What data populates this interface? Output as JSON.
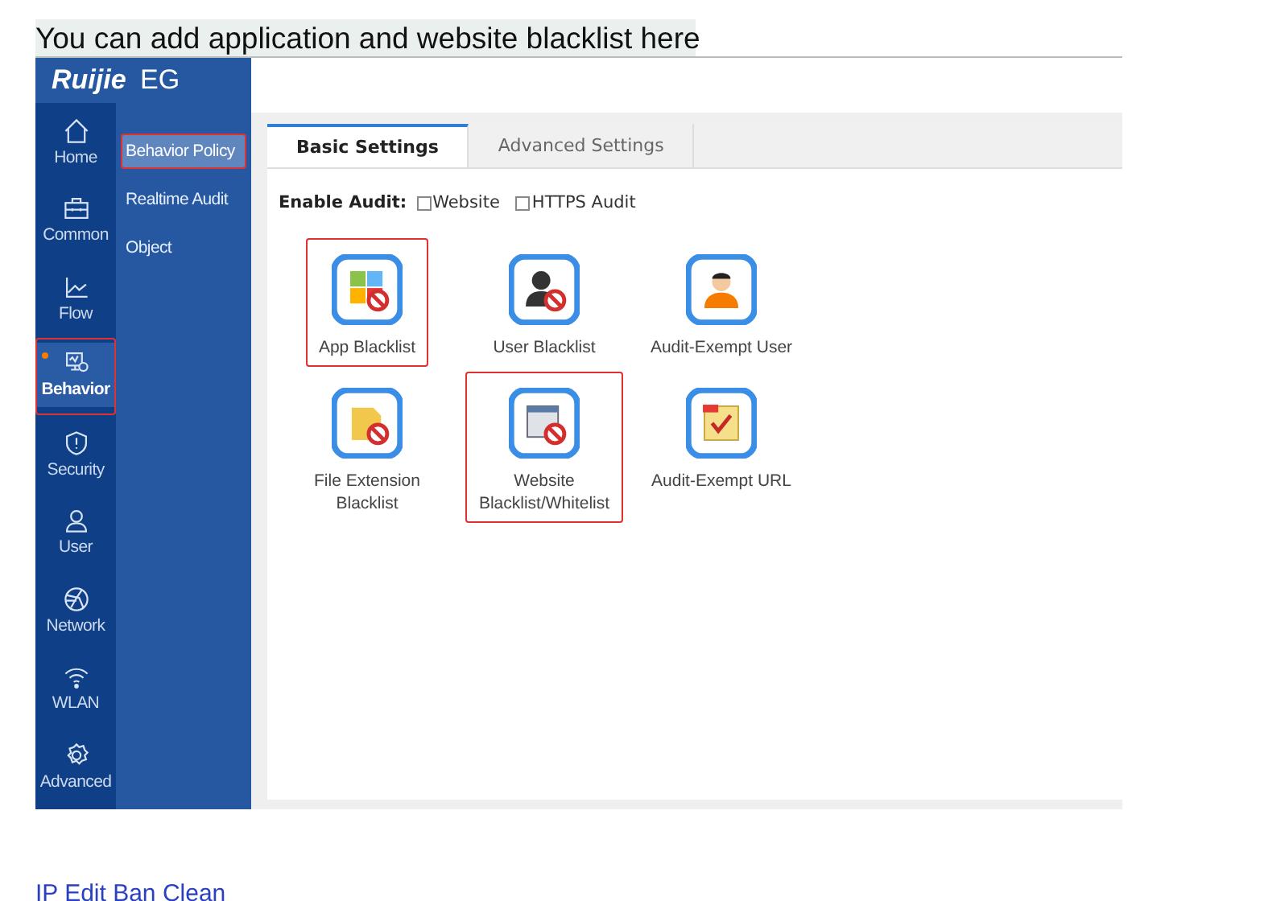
{
  "heading": "You can add application and website blacklist here",
  "app": {
    "logo": {
      "brand": "Ruijie",
      "product": "EG"
    },
    "nav": [
      {
        "label": "Home",
        "kind": "home",
        "selected": false,
        "highlighted": false
      },
      {
        "label": "Common",
        "kind": "toolbox",
        "selected": false,
        "highlighted": false
      },
      {
        "label": "Flow",
        "kind": "chart",
        "selected": false,
        "highlighted": false
      },
      {
        "label": "Behavior",
        "kind": "monitor",
        "selected": true,
        "highlighted": true
      },
      {
        "label": "Security",
        "kind": "shield",
        "selected": false,
        "highlighted": false
      },
      {
        "label": "User",
        "kind": "user",
        "selected": false,
        "highlighted": false
      },
      {
        "label": "Network",
        "kind": "globe",
        "selected": false,
        "highlighted": false
      },
      {
        "label": "WLAN",
        "kind": "wifi",
        "selected": false,
        "highlighted": false
      },
      {
        "label": "Advanced",
        "kind": "gear",
        "selected": false,
        "highlighted": false
      }
    ],
    "submenu": [
      {
        "label": "Behavior Policy",
        "selected": true,
        "highlighted": true
      },
      {
        "label": "Realtime Audit",
        "selected": false,
        "highlighted": false
      },
      {
        "label": "Object",
        "selected": false,
        "highlighted": false
      }
    ],
    "tabs": [
      {
        "label": "Basic Settings",
        "selected": true
      },
      {
        "label": "Advanced Settings",
        "selected": false
      }
    ],
    "enable_audit": {
      "label": "Enable Audit:",
      "options": [
        {
          "label": "Website",
          "checked": false
        },
        {
          "label": "HTTPS Audit",
          "checked": false
        }
      ]
    },
    "tiles": [
      {
        "label": "App Blacklist",
        "kind": "apps",
        "highlighted": true
      },
      {
        "label": "User Blacklist",
        "kind": "user-ban",
        "highlighted": false
      },
      {
        "label": "Audit-Exempt User",
        "kind": "person",
        "highlighted": false
      },
      {
        "label": "File Extension Blacklist",
        "kind": "file-ban",
        "highlighted": false
      },
      {
        "label": "Website Blacklist/Whitelist",
        "kind": "web-ban",
        "highlighted": true
      },
      {
        "label": "Audit-Exempt URL",
        "kind": "url",
        "highlighted": false
      }
    ]
  },
  "footer_link": "IP Edit Ban Clean"
}
